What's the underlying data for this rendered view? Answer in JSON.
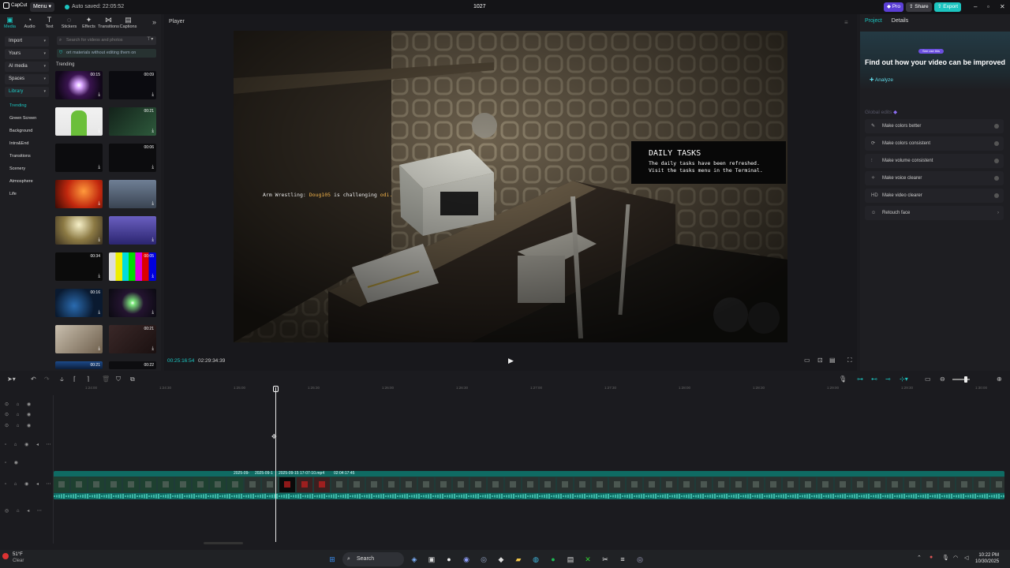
{
  "titlebar": {
    "app_name": "CapCut",
    "menu_label": "Menu",
    "saved_text": "Auto saved: 22:05:52",
    "project_title": "1027",
    "pro_label": "Pro",
    "share_label": "Share",
    "export_label": "Export",
    "colors": {
      "accent": "#1cc5c0",
      "pro": "#5b3fd6",
      "share": "#3a3a40",
      "export": "#1cc5c0"
    }
  },
  "media_tools": [
    {
      "label": "Media",
      "icon": "media-icon",
      "glyph": "▣"
    },
    {
      "label": "Audio",
      "icon": "audio-icon",
      "glyph": "◔"
    },
    {
      "label": "Text",
      "icon": "text-icon",
      "glyph": "T"
    },
    {
      "label": "Stickers",
      "icon": "sticker-icon",
      "glyph": "◌"
    },
    {
      "label": "Effects",
      "icon": "effects-icon",
      "glyph": "✦"
    },
    {
      "label": "Transitions",
      "icon": "transitions-icon",
      "glyph": "⋈"
    },
    {
      "label": "Captions",
      "icon": "captions-icon",
      "glyph": "▤"
    }
  ],
  "media_sidebar": {
    "selects": [
      "Import",
      "Yours",
      "AI media",
      "Spaces",
      "Library"
    ],
    "categories": [
      "Trending",
      "Green Screen",
      "Background",
      "Intro&End",
      "Transitions",
      "Scenery",
      "Atmosphere",
      "Life"
    ]
  },
  "media_browser": {
    "search_placeholder": "Search for videos and photos",
    "notice": "ort materials without editing them on",
    "section_label": "Trending",
    "thumbs": [
      {
        "dur": "00:15"
      },
      {
        "dur": "00:09"
      },
      {
        "dur": ""
      },
      {
        "dur": "00:21"
      },
      {
        "dur": ""
      },
      {
        "dur": "00:06"
      },
      {
        "dur": ""
      },
      {
        "dur": ""
      },
      {
        "dur": ""
      },
      {
        "dur": ""
      },
      {
        "dur": "00:34"
      },
      {
        "dur": "00:05"
      },
      {
        "dur": "00:16"
      },
      {
        "dur": ""
      },
      {
        "dur": ""
      },
      {
        "dur": "00:21"
      },
      {
        "dur": "00:21"
      },
      {
        "dur": "00:22"
      }
    ]
  },
  "player": {
    "label": "Player",
    "current_time": "00:25:16:54",
    "total_time": "02:29:34:39",
    "overlay_tasks_title": "DAILY TASKS",
    "overlay_tasks_line1": "The daily tasks have been refreshed.",
    "overlay_tasks_line2": "Visit the tasks menu in the Terminal.",
    "arm_prefix": "Arm Wrestling: ",
    "arm_name": "Doug105",
    "arm_mid": " is challenging ",
    "arm_target": "odi."
  },
  "details_panel": {
    "tabs": [
      "Project",
      "Details"
    ],
    "pill": "See use this",
    "banner_title": "Find out how your video can be improved",
    "analyze_label": "Analyze",
    "global_edits_label": "Global edits",
    "options": [
      {
        "label": "Make colors better",
        "icon": "colors-icon",
        "glyph": "✎"
      },
      {
        "label": "Make colors consistent",
        "icon": "consistent-icon",
        "glyph": "⟳"
      },
      {
        "label": "Make volume consistent",
        "icon": "volume-icon",
        "glyph": "⫶"
      },
      {
        "label": "Make voice clearer",
        "icon": "voice-icon",
        "glyph": "✧"
      },
      {
        "label": "Make video clearer",
        "icon": "hd-icon",
        "glyph": "HD"
      },
      {
        "label": "Retouch face",
        "icon": "face-icon",
        "glyph": "☺"
      }
    ]
  },
  "timeline": {
    "ruler_labels": [
      "1:24:00",
      "1:24:30",
      "1:25:00",
      "1:25:30",
      "1:26:00",
      "1:26:30",
      "1:27:00",
      "1:27:30",
      "1:28:00",
      "1:28:30",
      "1:29:00",
      "1:29:30",
      "1:30:00"
    ],
    "clip_labels": [
      "2025-09-",
      "2025-09-1",
      "2025-09-15 17-07-10.mp4",
      "02:04:17:45"
    ]
  },
  "taskbar": {
    "weather_temp": "51°F",
    "weather_desc": "Clear",
    "search_label": "Search",
    "time": "10:22 PM",
    "date": "10/30/2025"
  }
}
